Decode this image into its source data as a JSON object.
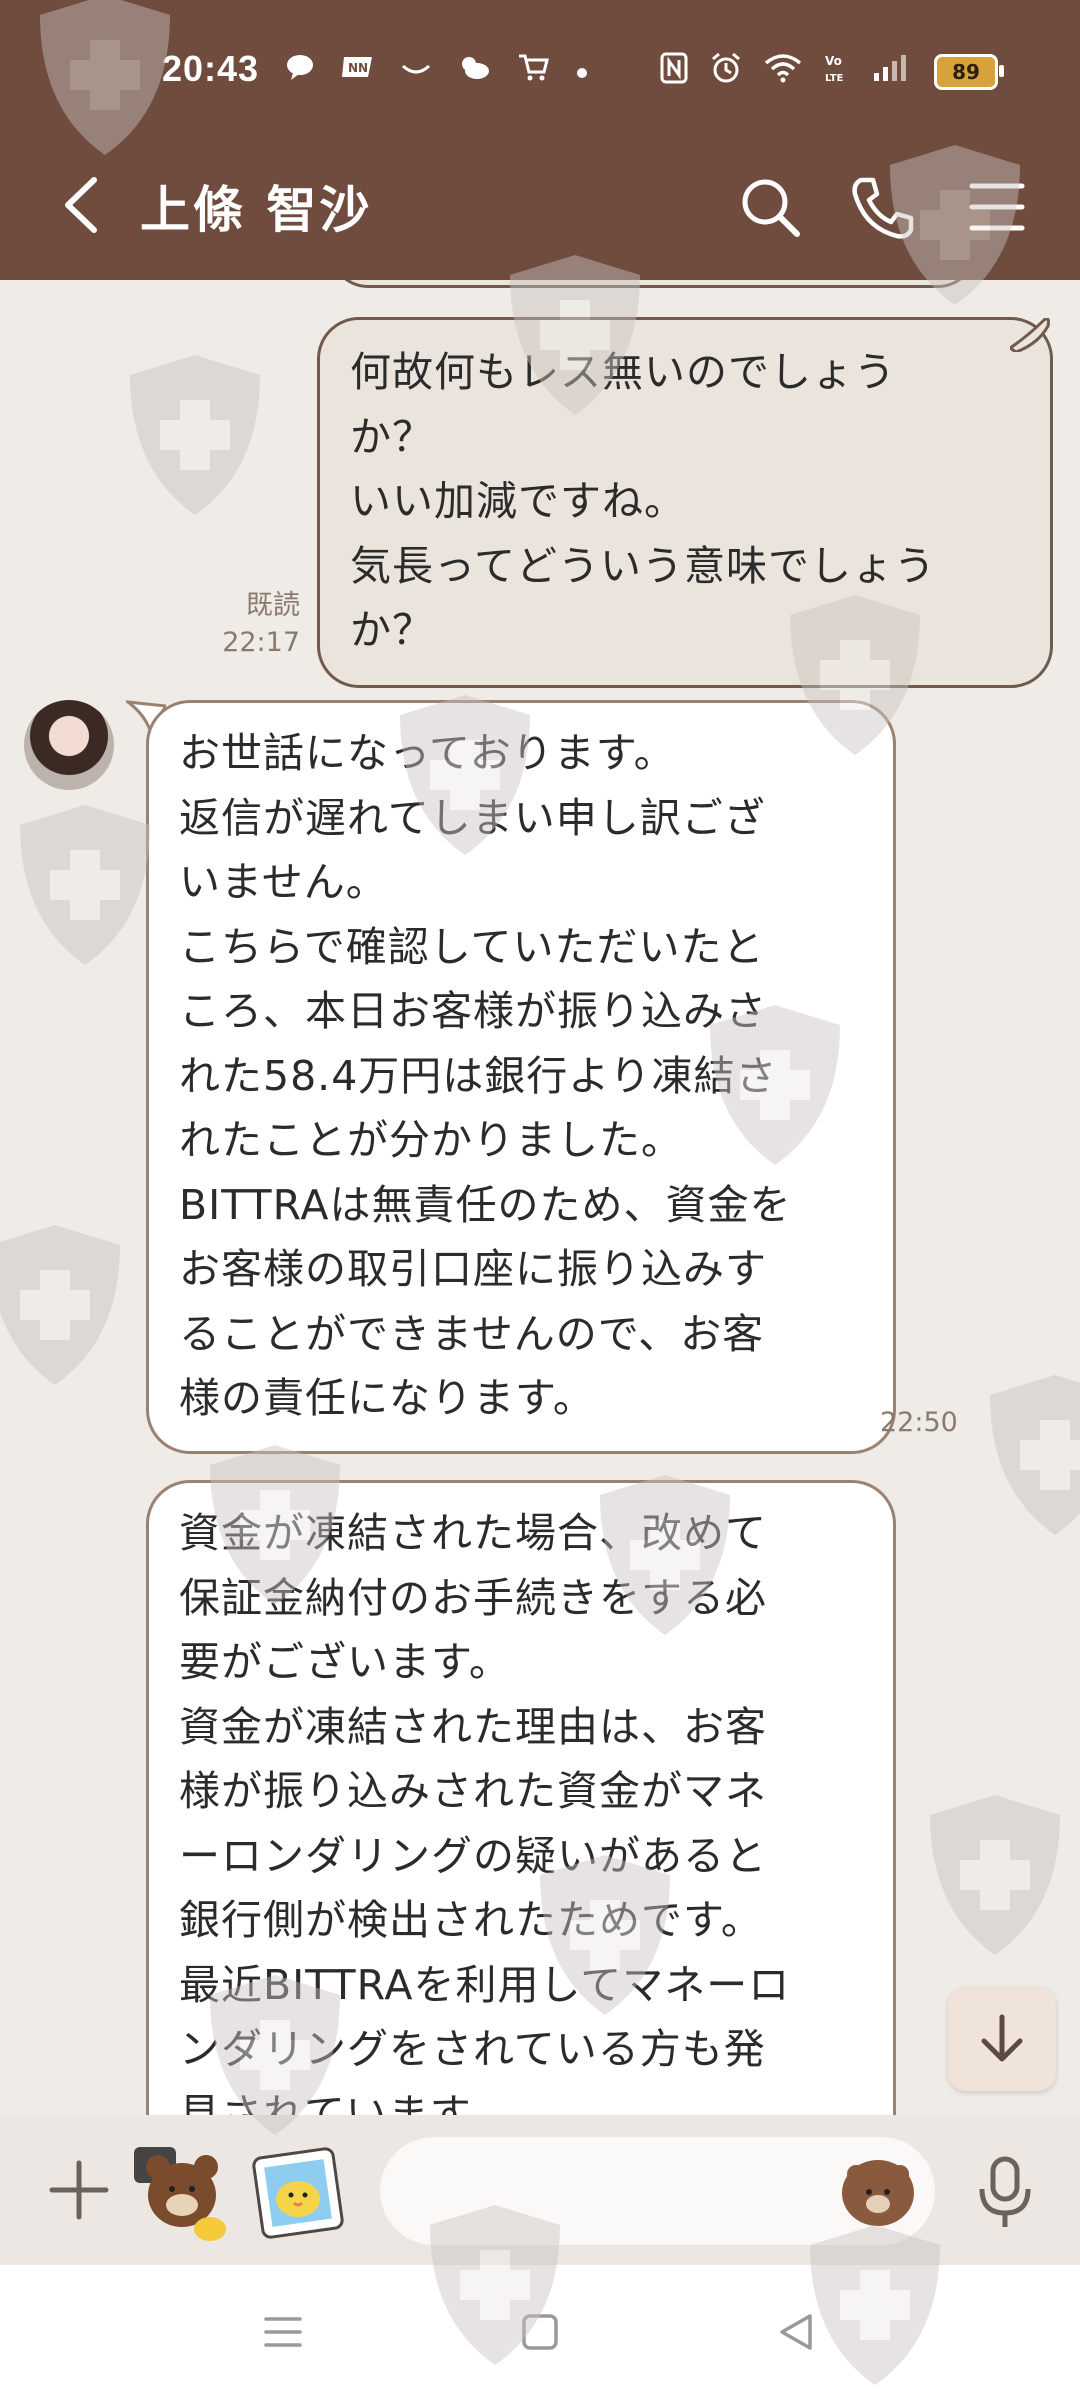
{
  "status_bar": {
    "time": "20:43",
    "battery": "89",
    "left_icons": [
      "chat-notification-icon",
      "news-app-icon",
      "link-icon",
      "weather-icon",
      "shopping-cart-icon",
      "dot-icon"
    ],
    "right_icons": [
      "nfc-icon",
      "alarm-icon",
      "wifi-icon",
      "volte-icon",
      "signal-icon",
      "battery-icon"
    ]
  },
  "header": {
    "contact_name": "上條 智沙",
    "actions": [
      "search-icon",
      "phone-icon",
      "menu-icon"
    ]
  },
  "messages": {
    "sent": {
      "lines": [
        "何故何もレス無いのでしょう",
        "か？",
        "いい加減ですね。",
        "気長ってどういう意味でしょう",
        "か？"
      ],
      "read_label": "既読",
      "time": "22:17"
    },
    "received_1": {
      "lines": [
        "お世話になっております。",
        "返信が遅れてしまい申し訳ござ",
        "いません。",
        "こちらで確認していただいたと",
        "ころ、本日お客様が振り込みさ",
        "れた58.4万円は銀行より凍結さ",
        "れたことが分かりました。",
        "BITTRAは無責任のため、資金を",
        "お客様の取引口座に振り込みす",
        "ることができませんので、お客",
        "様の責任になります。"
      ],
      "time": "22:50"
    },
    "received_2": {
      "lines": [
        "資金が凍結された場合、改めて",
        "保証金納付のお手続きをする必",
        "要がございます。",
        "資金が凍結された理由は、お客",
        "様が振り込みされた資金がマネ",
        "ーロンダリングの疑いがあると",
        "銀行側が検出されたためです。",
        "最近BITTRAを利用してマネーロ",
        "ンダリングをされている方も発",
        "見されています。"
      ]
    }
  },
  "input_bar": {
    "placeholder": "",
    "icons": [
      "plus-icon",
      "sticker-icon",
      "photo-icon",
      "emoji-icon",
      "microphone-icon"
    ]
  },
  "colors": {
    "header_bg": "#6f4c3e",
    "chat_bg": "#efebe6",
    "sent_bubble": "#ebe4dc",
    "received_bubble": "#ffffff"
  }
}
